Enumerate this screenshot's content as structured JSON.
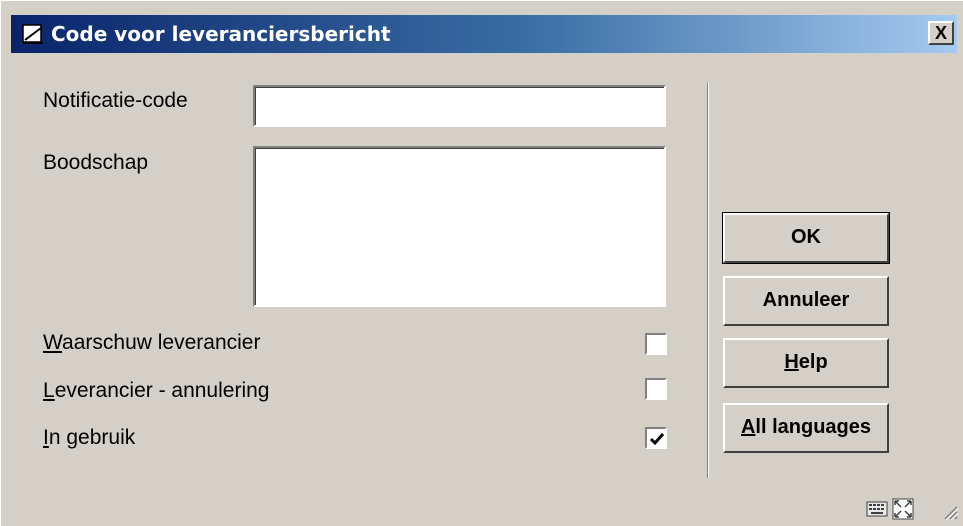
{
  "window": {
    "title": "Code voor leveranciersbericht",
    "close_label": "X"
  },
  "form": {
    "notification_code_label": "Notificatie-code",
    "notification_code_value": "",
    "message_label": "Boodschap",
    "message_value": "",
    "warn_supplier": {
      "accel": "W",
      "rest": "aarschuw leverancier",
      "checked": false
    },
    "supplier_cancel": {
      "accel": "L",
      "rest": "everancier - annulering",
      "checked": false
    },
    "in_use": {
      "accel": "I",
      "rest": "n gebruik",
      "checked": true
    }
  },
  "buttons": {
    "ok": "OK",
    "cancel": "Annuleer",
    "help_accel": "H",
    "help_rest": "elp",
    "all_languages_accel": "A",
    "all_languages_rest": "ll languages"
  },
  "status_bar": {
    "icons": [
      "keyboard-icon",
      "resize-icon",
      "size-grip-icon"
    ]
  }
}
